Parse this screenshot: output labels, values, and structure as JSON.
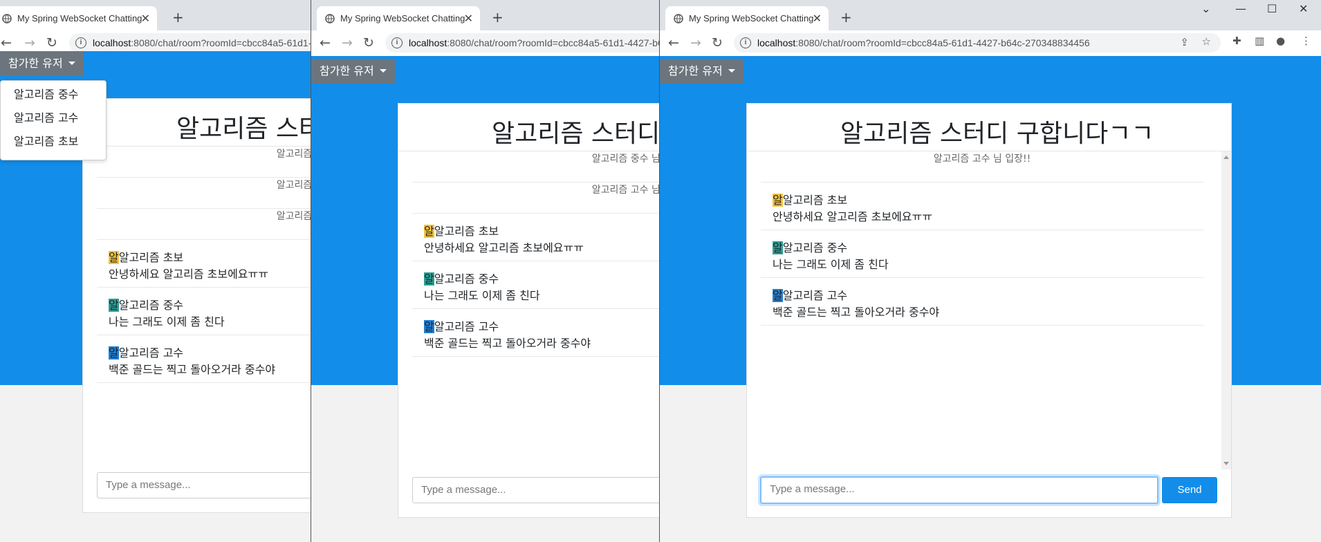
{
  "tab_title": "My Spring WebSocket Chatting",
  "url_host": "localhost",
  "url_rest": ":8080/chat/room?roomId=cbcc84a5-61d1-4427-b64c-270348834456",
  "users_button": "참가한 유저",
  "users": [
    "알고리즘 중수",
    "알고리즘 고수",
    "알고리즘 초보"
  ],
  "room_title": "알고리즘 스터디 구합니다ㄱㄱ",
  "sys_messages": [
    "알고리즘 중수 님 입장!!",
    "알고리즘 고수 님 입장!!",
    "알고리즘 초보 님 입장!!"
  ],
  "avatar_char": "알",
  "messages": [
    {
      "name": "알고리즘 초보",
      "text": "안녕하세요 알고리즘 초보에요ㅠㅠ",
      "color": "#f5c33b"
    },
    {
      "name": "알고리즘 중수",
      "text": "나는 그래도 이제 좀 친다",
      "color": "#2aa198"
    },
    {
      "name": "알고리즘 고수",
      "text": "백준 골드는 찍고 돌아오거라 중수야",
      "color": "#1f7fd6"
    }
  ],
  "input_placeholder": "Type a message...",
  "send_label": "Send",
  "icons": {
    "globe": "globe-icon",
    "close": "close-icon",
    "back": "back-arrow-icon",
    "forward": "forward-arrow-icon",
    "reload": "reload-icon",
    "info": "info-icon"
  },
  "accent": "#128de9"
}
